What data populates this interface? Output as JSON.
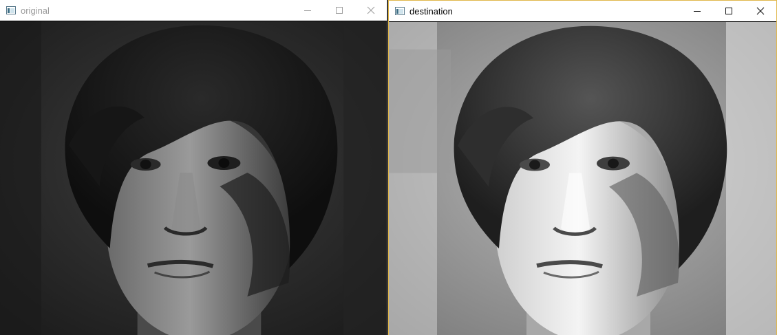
{
  "windows": {
    "original": {
      "title": "original",
      "image_icon": "person-face-photo-grayscale",
      "controls": {
        "minimize_icon": "minimize-icon",
        "maximize_icon": "maximize-icon",
        "close_icon": "close-icon"
      }
    },
    "destination": {
      "title": "destination",
      "image_icon": "person-face-photo-grayscale-brightened",
      "controls": {
        "minimize_icon": "minimize-icon",
        "maximize_icon": "maximize-icon",
        "close_icon": "close-icon"
      }
    }
  },
  "colors": {
    "titlebar": "#ffffff",
    "inactive_title_text": "#9a9a9a",
    "active_title_text": "#000000",
    "active_border": "#e0b64a"
  }
}
